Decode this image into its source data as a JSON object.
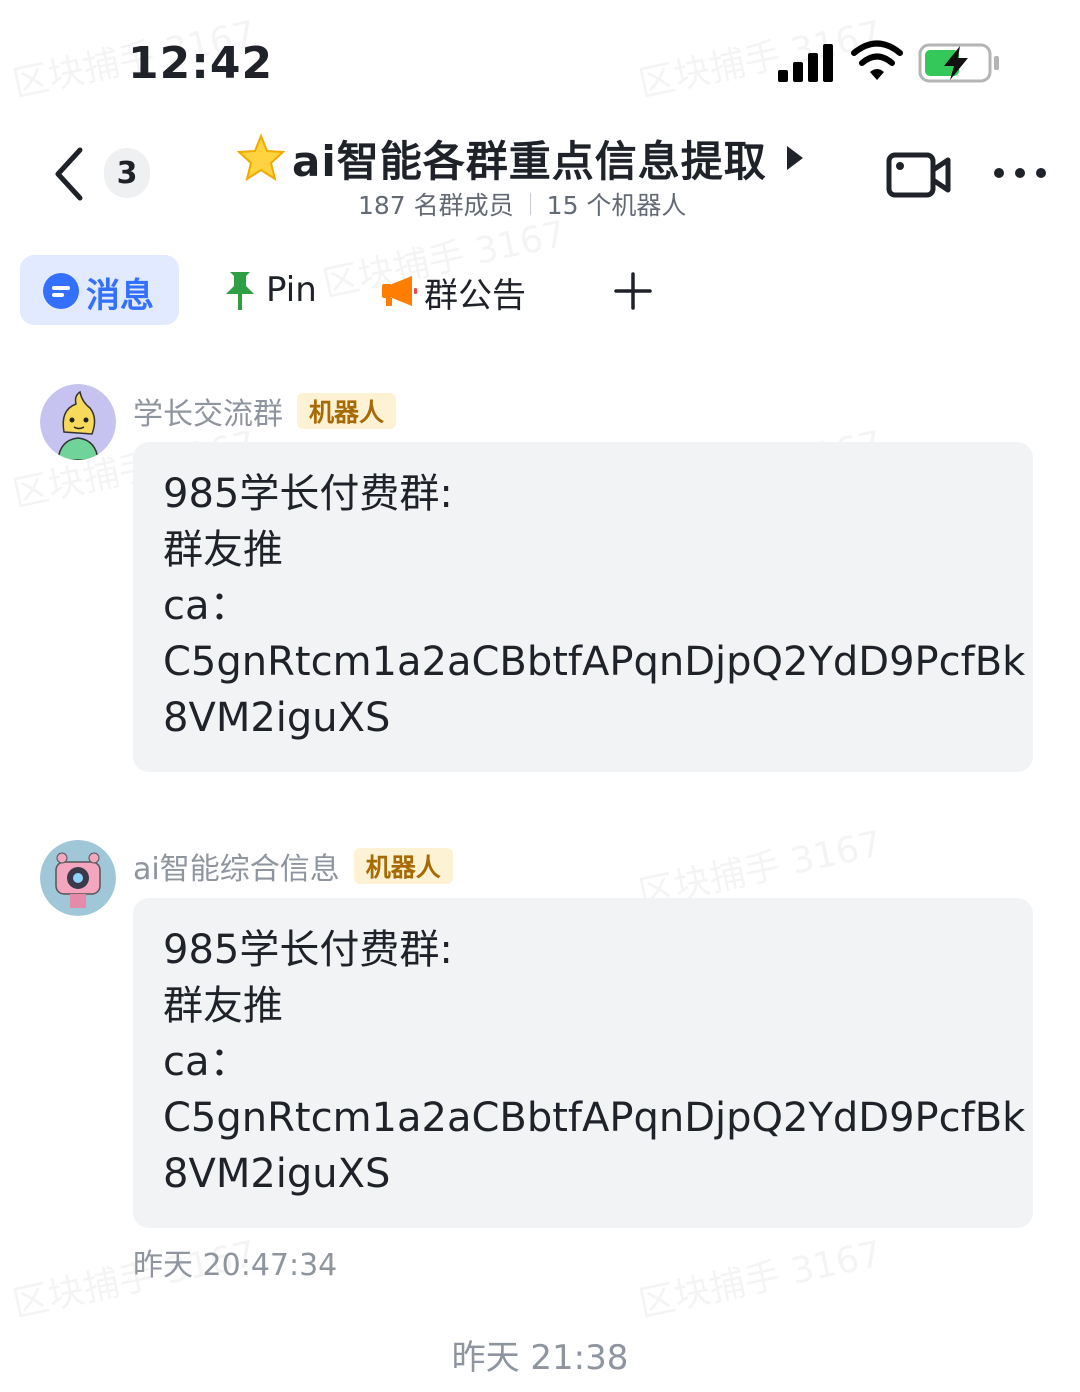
{
  "status_bar": {
    "time": "12:42"
  },
  "header": {
    "back_count": "3",
    "title": "ai智能各群重点信息提取",
    "member_count": "187 名群成员",
    "bot_count": "15 个机器人"
  },
  "tabs": [
    {
      "label": "消息"
    },
    {
      "label": "Pin"
    },
    {
      "label": "群公告"
    }
  ],
  "messages": [
    {
      "sender": "学长交流群",
      "tag": "机器人",
      "lines": [
        "985学长付费群:",
        "群友推",
        "ca：",
        "C5gnRtcm1a2aCBbtfAPqnDjpQ2YdD9PcfBk",
        "8VM2iguXS"
      ]
    },
    {
      "sender": "ai智能综合信息",
      "tag": "机器人",
      "lines": [
        "985学长付费群:",
        "群友推",
        "ca：",
        "C5gnRtcm1a2aCBbtfAPqnDjpQ2YdD9PcfBk",
        "8VM2iguXS"
      ],
      "timestamp": "昨天 20:47:34"
    }
  ],
  "time_divider": "昨天 21:38",
  "watermark": "区块捕手 3167",
  "colors": {
    "accent": "#3370ff",
    "tab_active_bg": "#e1eaff",
    "bubble_bg": "#f2f3f5",
    "robot_tag_bg": "#fdf3d4",
    "robot_tag_text": "#a86a05"
  }
}
